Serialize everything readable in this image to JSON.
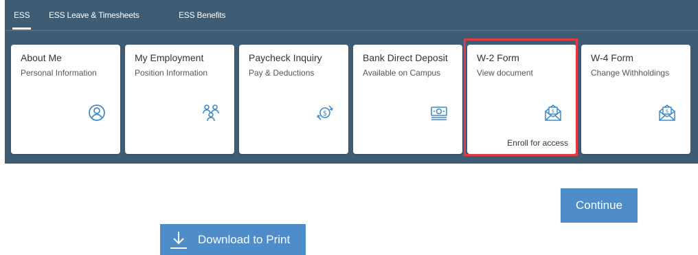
{
  "nav": {
    "tabs": [
      {
        "label": "ESS",
        "active": true
      },
      {
        "label": "ESS Leave & Timesheets",
        "active": false
      },
      {
        "label": "ESS Benefits",
        "active": false
      }
    ]
  },
  "tiles": [
    {
      "title": "About Me",
      "subtitle": "Personal Information",
      "icon": "person-circle-icon"
    },
    {
      "title": "My Employment",
      "subtitle": "Position Information",
      "icon": "group-people-icon"
    },
    {
      "title": "Paycheck Inquiry",
      "subtitle": "Pay & Deductions",
      "icon": "money-exchange-icon"
    },
    {
      "title": "Bank Direct Deposit",
      "subtitle": "Available on Campus",
      "icon": "banknote-icon"
    },
    {
      "title": "W-2 Form",
      "subtitle": "View document",
      "footer": "Enroll for access",
      "icon": "envelope-document-icon",
      "highlighted": true
    },
    {
      "title": "W-4 Form",
      "subtitle": "Change Withholdings",
      "icon": "envelope-document-icon"
    }
  ],
  "actions": {
    "continue_label": "Continue",
    "download_label": "Download to Print"
  },
  "colors": {
    "header_bg": "#3e5c74",
    "icon_color": "#3f8ac9",
    "button_bg": "#4e8dca",
    "highlight_border": "#e23b45"
  }
}
